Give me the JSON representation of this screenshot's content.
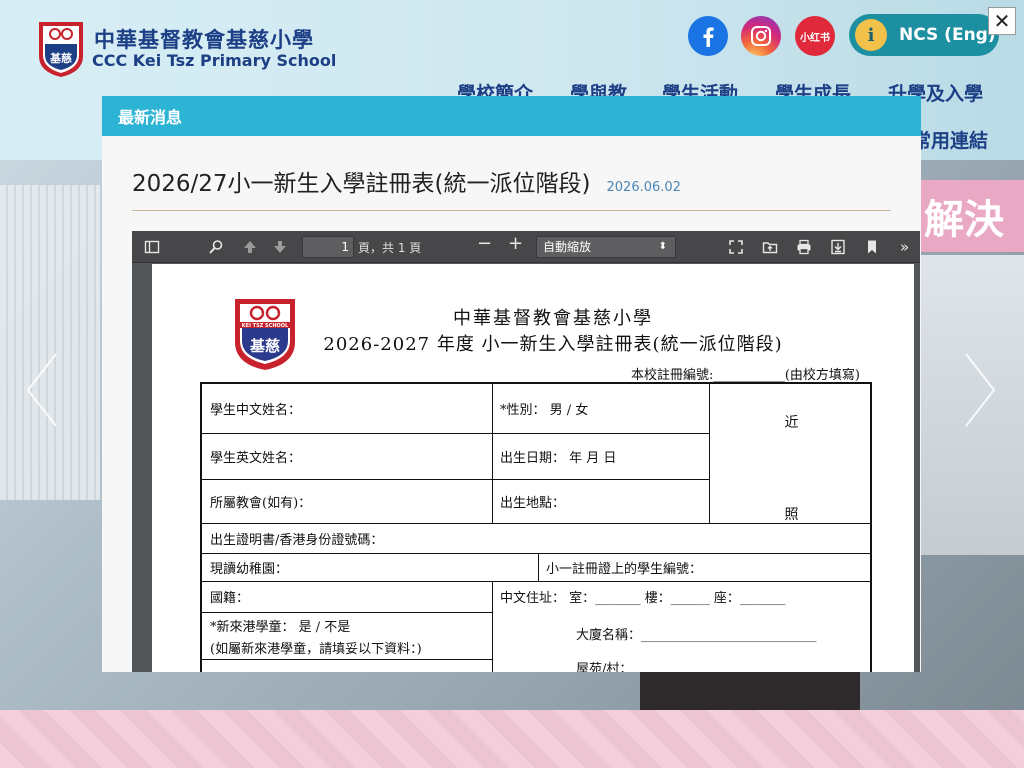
{
  "site": {
    "school_name_cn": "中華基督教會基慈小學",
    "school_name_en": "CCC Kei Tsz Primary School",
    "logo_text": "基慈",
    "ncs_label": "NCS (Eng)",
    "xhs_label": "小红书",
    "hero_text": "解決"
  },
  "nav": {
    "items": [
      "學校簡介",
      "學與教",
      "學生活動",
      "學生成長",
      "升學及入學"
    ],
    "second_row": "常用連結"
  },
  "modal": {
    "header": "最新消息",
    "post_title": "2026/27小一新生入學註冊表(統一派位階段)",
    "post_date": "2026.06.02"
  },
  "pdf_toolbar": {
    "page_current": "1",
    "page_of": "頁，共 1 頁",
    "zoom": "自動縮放"
  },
  "document": {
    "title1": "中華基督教會基慈小學",
    "title2": "2026-2027 年度  小一新生入學註冊表(統一派位階段)",
    "reg_line": "本校註冊編號:___________(由校方填寫)",
    "logo_top": "KEI TSZ SCHOOL",
    "logo_char": "基慈",
    "fields": {
      "name_cn": "學生中文姓名：",
      "gender": "*性別：  男  /  女",
      "photo_1": "近",
      "photo_2": "照",
      "name_en": "學生英文姓名：",
      "dob": "出生日期：     年   月   日",
      "church": "所屬教會(如有)：",
      "birthplace": "出生地點：",
      "id_no": "出生證明書/香港身份證號碼：",
      "kindergarten": "現讀幼稚園：",
      "p1_reg_no": "小一註冊證上的學生編號：",
      "nationality": "國籍：",
      "address": "中文住址：  室：_______   樓：______   座：_______",
      "newcomer": "*新來港學童：   是  /  不是",
      "newcomer_note": "(如屬新來港學童，請填妥以下資料：)",
      "building": "大廈名稱：___________________________",
      "estate": "屋苑/村："
    }
  },
  "colors": {
    "brand_blue": "#1d3f86",
    "modal_header": "#2db3d4",
    "ncs_button": "#1c8fa0",
    "date_blue": "#4a86b8"
  }
}
